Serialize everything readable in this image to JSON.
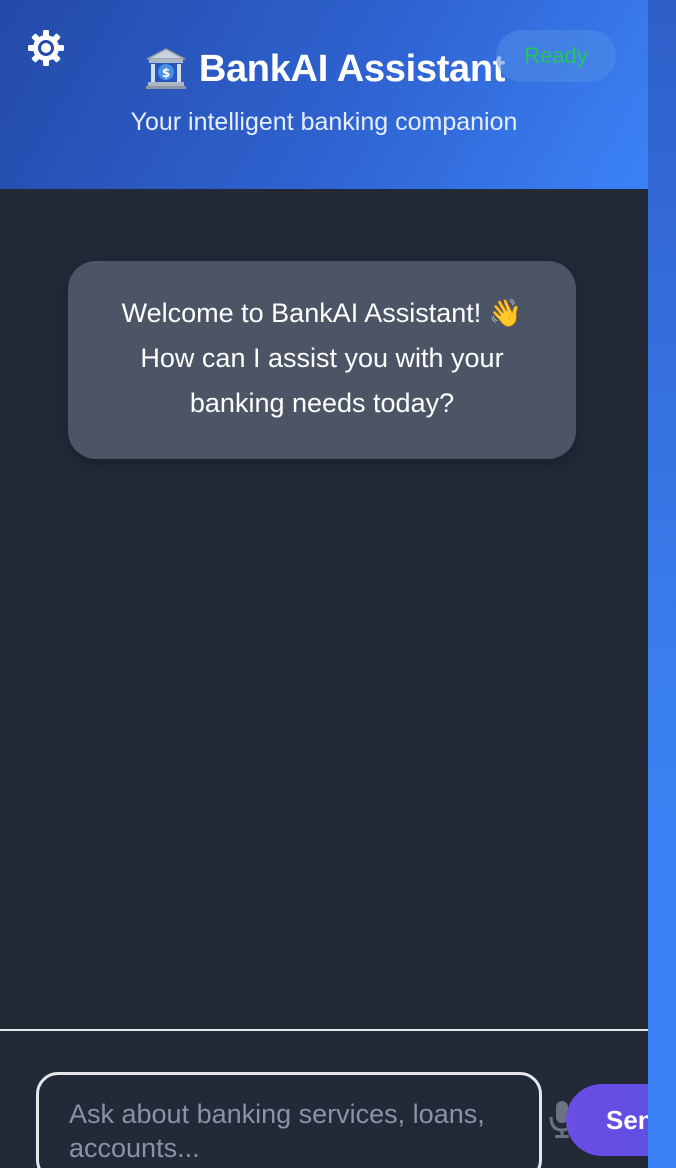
{
  "header": {
    "title": "BankAI Assistant",
    "subtitle": "Your intelligent banking companion",
    "status": "Ready",
    "settings_icon": "gear-icon",
    "title_icon": "bank-icon"
  },
  "chat": {
    "messages": [
      {
        "role": "assistant",
        "text": "Welcome to BankAI Assistant! 👋 How can I assist you with your banking needs today?"
      }
    ]
  },
  "composer": {
    "placeholder": "Ask about banking services, loans, accounts...",
    "value": "",
    "mic_icon": "microphone-icon",
    "send_label": "Send"
  },
  "colors": {
    "header_start": "#234aa8",
    "header_end": "#3b82f6",
    "chat_background": "#222a38",
    "bubble_background": "#4b5565",
    "status_text": "#22c55e",
    "send_button": "#5b4fe0"
  }
}
